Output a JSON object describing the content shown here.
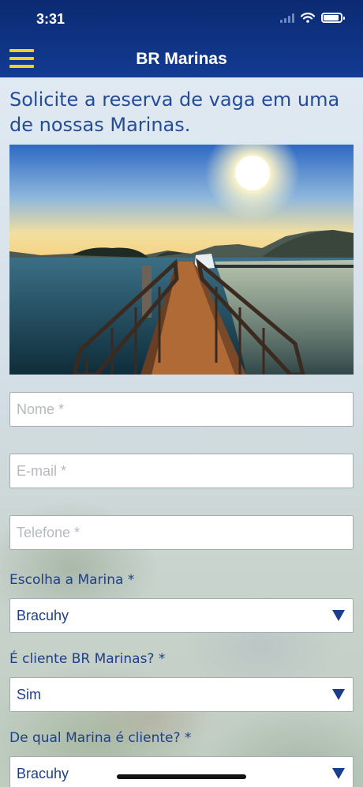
{
  "status_bar": {
    "time": "3:31"
  },
  "header": {
    "title": "BR Marinas",
    "menu_icon": "hamburger-menu-icon",
    "accent_color": "#f2d21b",
    "bar_color": "#0b2a72"
  },
  "intro": {
    "text": "Solicite a reserva de vaga em uma de nossas Marinas."
  },
  "hero": {
    "image": "pier-sunset-photo"
  },
  "form": {
    "name": {
      "placeholder": "Nome *",
      "value": ""
    },
    "email": {
      "placeholder": "E-mail *",
      "value": ""
    },
    "phone": {
      "placeholder": "Telefone *",
      "value": ""
    },
    "marina": {
      "label": "Escolha a Marina *",
      "selected": "Bracuhy"
    },
    "is_client": {
      "label": "É cliente BR Marinas? *",
      "selected": "Sim"
    },
    "client_marina": {
      "label": "De qual Marina é cliente? *",
      "selected": "Bracuhy"
    }
  }
}
